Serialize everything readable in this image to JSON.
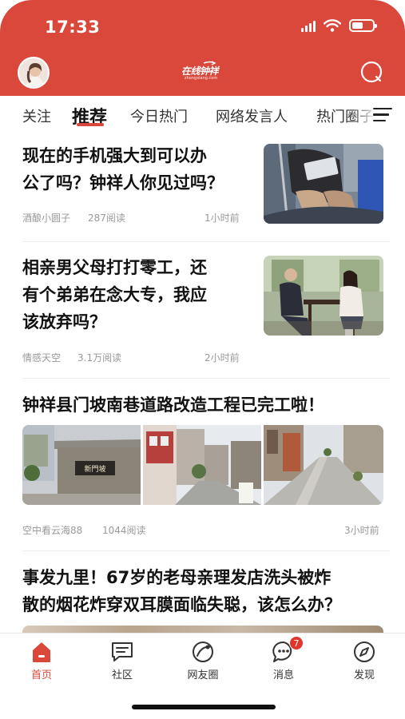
{
  "status_bar": {
    "time": "17:33"
  },
  "header": {
    "logo_text": "在线钟祥",
    "logo_sub": "zhongxiang.com"
  },
  "tabs": [
    "关注",
    "推荐",
    "今日热门",
    "网络发言人",
    "热门圈子"
  ],
  "active_tab": "推荐",
  "feed": [
    {
      "title_lines": [
        "现在的手机强大到可以办",
        "公了吗？钟祥人你见过吗？"
      ],
      "author": "酒酿小圆子",
      "reads": "287阅读",
      "time": "1小时前"
    },
    {
      "title_lines": [
        "相亲男父母打打零工，还",
        "有个弟弟在念大专，我应",
        "该放弃吗？"
      ],
      "author": "情感天空",
      "reads": "3.1万阅读",
      "time": "2小时前"
    },
    {
      "title_lines": [
        "钟祥县门坡南巷道路改造工程已完工啦！"
      ],
      "author": "空中看云海88",
      "reads": "1044阅读",
      "time": "3小时前",
      "image_sign": "新門坡"
    },
    {
      "title_lines": [
        "事发九里！67岁的老母亲理发店洗头被炸",
        "散的烟花炸穿双耳膜面临失聪，该怎么办？"
      ]
    }
  ],
  "tabbar": [
    {
      "label": "首页",
      "icon": "home-icon",
      "active": true
    },
    {
      "label": "社区",
      "icon": "community-icon",
      "active": false
    },
    {
      "label": "网友圈",
      "icon": "friends-circle-icon",
      "active": false
    },
    {
      "label": "消息",
      "icon": "message-icon",
      "active": false,
      "badge": "7"
    },
    {
      "label": "发现",
      "icon": "compass-icon",
      "active": false
    }
  ],
  "colors": {
    "brand": "#d9483b",
    "badge": "#e0362c",
    "meta": "#999999"
  }
}
